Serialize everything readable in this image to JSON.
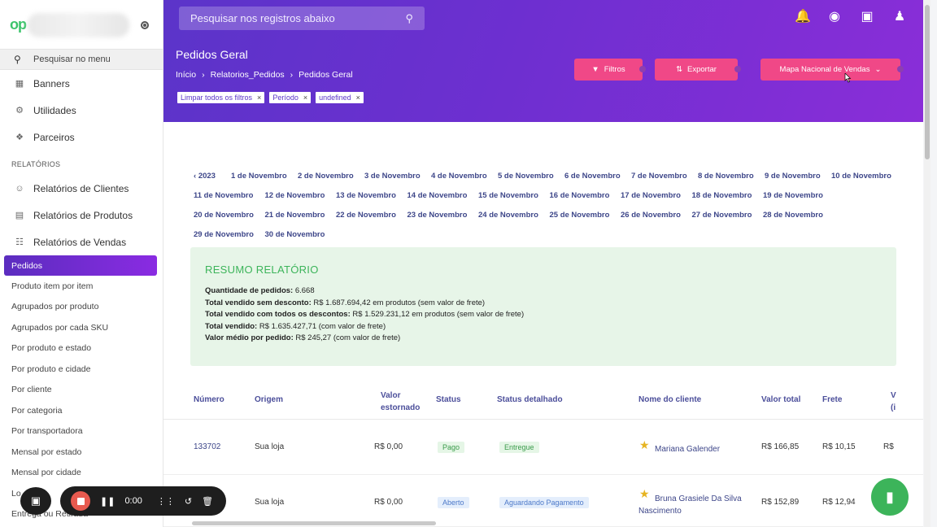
{
  "sidebar": {
    "search_label": "Pesquisar no menu",
    "items": [
      {
        "label": "Banners",
        "icon": "image-icon"
      },
      {
        "label": "Utilidades",
        "icon": "gear-icon"
      },
      {
        "label": "Parceiros",
        "icon": "handshake-icon"
      }
    ],
    "section_label": "RELATÓRIOS",
    "report_items": [
      {
        "label": "Relatórios de Clientes",
        "icon": "users-icon"
      },
      {
        "label": "Relatórios de Produtos",
        "icon": "boxes-icon"
      },
      {
        "label": "Relatórios de Vendas",
        "icon": "table-icon"
      }
    ],
    "sub_items": [
      "Pedidos",
      "Produto item por item",
      "Agrupados por produto",
      "Agrupados por cada SKU",
      "Por produto e estado",
      "Por produto e cidade",
      "Por cliente",
      "Por categoria",
      "Por transportadora",
      "Mensal por estado",
      "Mensal por cidade",
      "Lo",
      "Entrega ou Retirada"
    ]
  },
  "header": {
    "search_placeholder": "Pesquisar nos registros abaixo",
    "page_title": "Pedidos Geral",
    "breadcrumb": [
      "Início",
      "Relatorios_Pedidos",
      "Pedidos Geral"
    ],
    "breadcrumb_sep": "›",
    "chips": [
      "Limpar todos os filtros",
      "Período",
      "undefined"
    ],
    "buttons": {
      "filters": "Filtros",
      "export": "Exportar",
      "map": "Mapa Nacional de Vendas"
    }
  },
  "dates": {
    "year_link": "2023",
    "rows": [
      [
        "1 de Novembro",
        "2 de Novembro",
        "3 de Novembro",
        "4 de Novembro",
        "5 de Novembro",
        "6 de Novembro",
        "7 de Novembro",
        "8 de Novembro",
        "9 de Novembro",
        "10 de Novembro"
      ],
      [
        "11 de Novembro",
        "12 de Novembro",
        "13 de Novembro",
        "14 de Novembro",
        "15 de Novembro",
        "16 de Novembro",
        "17 de Novembro",
        "18 de Novembro",
        "19 de Novembro"
      ],
      [
        "20 de Novembro",
        "21 de Novembro",
        "22 de Novembro",
        "23 de Novembro",
        "24 de Novembro",
        "25 de Novembro",
        "26 de Novembro",
        "27 de Novembro",
        "28 de Novembro"
      ],
      [
        "29 de Novembro",
        "30 de Novembro"
      ]
    ]
  },
  "summary": {
    "title": "RESUMO RELATÓRIO",
    "lines": [
      {
        "label": "Quantidade de pedidos:",
        "value": " 6.668"
      },
      {
        "label": "Total vendido sem desconto:",
        "value": " R$ 1.687.694,42 em produtos (sem valor de frete)"
      },
      {
        "label": "Total vendido com todos os descontos:",
        "value": " R$ 1.529.231,12 em produtos (sem valor de frete)"
      },
      {
        "label": "Total vendido:",
        "value": " R$ 1.635.427,71 (com valor de frete)"
      },
      {
        "label": "Valor médio por pedido:",
        "value": " R$ 245,27 (com valor de frete)"
      }
    ]
  },
  "table": {
    "headers": {
      "numero": "Número",
      "origem": "Origem",
      "valor_estornado_1": "Valor",
      "valor_estornado_2": "estornado",
      "status": "Status",
      "status_detalhado": "Status detalhado",
      "cliente": "Nome do cliente",
      "valor_total": "Valor total",
      "frete": "Frete",
      "extra_1": "V",
      "extra_2": "(i"
    },
    "rows": [
      {
        "numero": "133702",
        "origem": "Sua loja",
        "valor_estornado": "R$ 0,00",
        "status": "Pago",
        "status_detalhado": "Entregue",
        "cliente": "Mariana Galender",
        "cliente_2": "",
        "valor_total": "R$ 166,85",
        "frete": "R$ 10,15",
        "extra": "R$"
      },
      {
        "numero": "",
        "origem": "Sua loja",
        "valor_estornado": "R$ 0,00",
        "status": "Aberto",
        "status_detalhado": "Aguardando Pagamento",
        "cliente": "Bruna Grasiele Da Silva",
        "cliente_2": "Nascimento",
        "valor_total": "R$ 152,89",
        "frete": "R$ 12,94",
        "extra": ""
      }
    ]
  },
  "recorder": {
    "time": "0:00"
  },
  "colors": {
    "header_start": "#5b34c9",
    "header_end": "#8a2ed8",
    "accent_pink": "#f04887",
    "summary_green": "#3cb45a",
    "chat_green": "#3cb45a"
  }
}
